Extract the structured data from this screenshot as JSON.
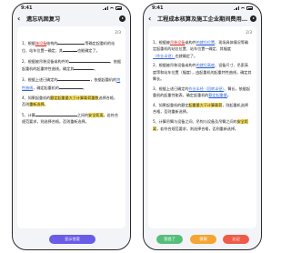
{
  "left": {
    "status_time": "9:41",
    "title": "遗忘巩固复习",
    "page_indicator": "2/3",
    "q1": {
      "a": "1、根据",
      "b": "施设备",
      "c": "结构的",
      "d": "等确定起重机的站位、站车位置一确定、其",
      "e": "也能确定了。"
    },
    "q2": {
      "a": "2、根据被吊装设备或构件的",
      "b": "，依据起重机的起重特性曲线，确定其",
      "c": "。"
    },
    "q3": {
      "a": "3、根据上述已确定的",
      "b": "，依据起重机的",
      "c": "特性曲线",
      "d": "，确定起重机的",
      "e": "。"
    },
    "q4": {
      "a": "4、如果起重机的",
      "b": "额定起重量大于计算载荷重数",
      "c": "选择合格，否则",
      "d": "重新选择",
      "e": "。"
    },
    "q5": {
      "a": "5、计算",
      "b": "之间的",
      "c": "安全距离",
      "d": "，若符合规范要求，则选择合格，否则重新选择。"
    },
    "show_answer": "显示答案"
  },
  "right": {
    "status_time": "9:41",
    "title": "工程成本核算及施工企业期间费用...",
    "page_indicator": "2/3",
    "q1": {
      "a": "1、根据被",
      "b": "吊装设备",
      "c": "或构件",
      "d": "的就位位置",
      "e": "、现场具体情况等确定起重机的站位位置、站车位置一确定、其幅度",
      "f": "（作业半径）",
      "g": "也就确定了。"
    },
    "q2": {
      "a": "2、根据被吊装设备或构件",
      "b": "的就位高度",
      "c": "、设备尺寸、吊索高度等和站车位置（幅度），由起重机的起重特性曲线，确定其臂长。"
    },
    "q3": {
      "a": "3、根据上述已确定的",
      "b": "作业半径（回转半径）",
      "c": "、臂长，依据起重机的起重性能表，确定起重机的",
      "d": "额定起重量",
      "e": "。"
    },
    "q4": {
      "a": "4、如果起重机的额定",
      "b": "起重量大于计算载荷",
      "c": "，则起重机选择合格，否则重新选择。"
    },
    "q5": {
      "a": "5、计算吊臂与设备之间、吊钩与设备及吊臂之间的",
      "b": "安全距离",
      "c": "，若符合规范要求，则选择合格，否则重新选择。"
    },
    "buttons": {
      "wrong": "我错了",
      "vague": "模糊",
      "forgot": "忘记"
    }
  }
}
